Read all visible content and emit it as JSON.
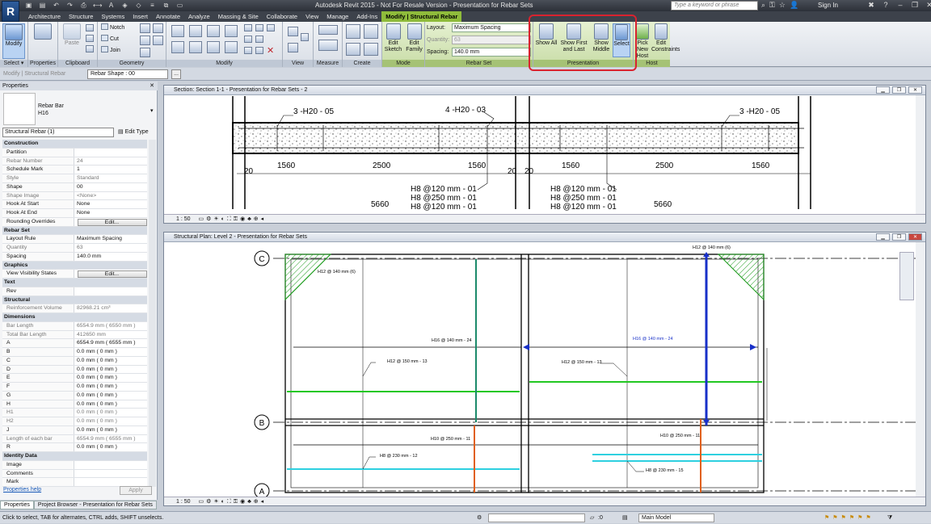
{
  "app": {
    "logo": "R",
    "window_title": "Autodesk Revit 2015 - Not For Resale Version -    Presentation for Rebar Sets",
    "search_placeholder": "Type a keyword or phrase",
    "sign_in": "Sign In"
  },
  "tabs": [
    "Architecture",
    "Structure",
    "Systems",
    "Insert",
    "Annotate",
    "Analyze",
    "Massing & Site",
    "Collaborate",
    "View",
    "Manage",
    "Add-Ins",
    "Modify | Structural Rebar"
  ],
  "active_tab_index": 11,
  "ribbon": {
    "select": {
      "modify": "Modify",
      "title": "Select ▾"
    },
    "properties": {
      "label": "Properties"
    },
    "clipboard": {
      "paste": "Paste",
      "title": "Clipboard"
    },
    "geometry": {
      "notch": "Notch",
      "cut": "Cut",
      "join": "Join",
      "title": "Geometry"
    },
    "modify": {
      "title": "Modify"
    },
    "view": {
      "title": "View"
    },
    "measure": {
      "title": "Measure"
    },
    "create": {
      "title": "Create"
    },
    "mode": {
      "edit_sketch": "Edit Sketch",
      "edit_family": "Edit Family",
      "title": "Mode"
    },
    "rebar_set": {
      "layout_label": "Layout:",
      "layout_value": "Maximum Spacing",
      "quantity_label": "Quantity:",
      "quantity_value": "63",
      "spacing_label": "Spacing:",
      "spacing_value": "140.0 mm",
      "title": "Rebar Set"
    },
    "presentation": {
      "show_all": "Show All",
      "show_first_last": "Show First and Last",
      "show_middle": "Show Middle",
      "select": "Select",
      "title": "Presentation"
    },
    "host": {
      "pick_new_host": "Pick New Host",
      "edit_constraints": "Edit Constraints",
      "title": "Host"
    }
  },
  "options_bar": {
    "label": "Modify | Structural Rebar",
    "rebar_shape": "Rebar Shape : 00",
    "more": "..."
  },
  "properties": {
    "header": "Properties",
    "type_name": "Rebar Bar",
    "type_sub": "H16",
    "instance_select": "Structural Rebar (1)",
    "edit_type": "Edit Type",
    "rows": [
      {
        "k": "Construction",
        "cat": true
      },
      {
        "k": "Partition",
        "v": ""
      },
      {
        "k": "Rebar Number",
        "v": "24",
        "ro": true
      },
      {
        "k": "Schedule Mark",
        "v": "1"
      },
      {
        "k": "Style",
        "v": "Standard",
        "ro": true
      },
      {
        "k": "Shape",
        "v": "00"
      },
      {
        "k": "Shape Image",
        "v": "<None>",
        "ro": true
      },
      {
        "k": "Hook At Start",
        "v": "None"
      },
      {
        "k": "Hook At End",
        "v": "None"
      },
      {
        "k": "Rounding Overrides",
        "v": "Edit...",
        "btn": true
      },
      {
        "k": "Rebar Set",
        "cat": true
      },
      {
        "k": "Layout Rule",
        "v": "Maximum Spacing"
      },
      {
        "k": "Quantity",
        "v": "63",
        "ro": true
      },
      {
        "k": "Spacing",
        "v": "140.0 mm"
      },
      {
        "k": "Graphics",
        "cat": true
      },
      {
        "k": "View Visibility States",
        "v": "Edit...",
        "btn": true
      },
      {
        "k": "Text",
        "cat": true
      },
      {
        "k": "Rev",
        "v": ""
      },
      {
        "k": "Structural",
        "cat": true
      },
      {
        "k": "Reinforcement Volume",
        "v": "82968.21 cm³",
        "ro": true
      },
      {
        "k": "Dimensions",
        "cat": true
      },
      {
        "k": "Bar Length",
        "v": "6554.9 mm ( 6550 mm )",
        "ro": true
      },
      {
        "k": "Total Bar Length",
        "v": "412650 mm",
        "ro": true
      },
      {
        "k": "A",
        "v": "6554.9 mm ( 6555 mm )"
      },
      {
        "k": "B",
        "v": "0.0 mm ( 0 mm )"
      },
      {
        "k": "C",
        "v": "0.0 mm ( 0 mm )"
      },
      {
        "k": "D",
        "v": "0.0 mm ( 0 mm )"
      },
      {
        "k": "E",
        "v": "0.0 mm ( 0 mm )"
      },
      {
        "k": "F",
        "v": "0.0 mm ( 0 mm )"
      },
      {
        "k": "G",
        "v": "0.0 mm ( 0 mm )"
      },
      {
        "k": "H",
        "v": "0.0 mm ( 0 mm )"
      },
      {
        "k": "H1",
        "v": "0.0 mm ( 0 mm )",
        "ro": true
      },
      {
        "k": "H2",
        "v": "0.0 mm ( 0 mm )",
        "ro": true
      },
      {
        "k": "J",
        "v": "0.0 mm ( 0 mm )"
      },
      {
        "k": "Length of each bar",
        "v": "6554.9 mm ( 6555 mm )",
        "ro": true
      },
      {
        "k": "R",
        "v": "0.0 mm ( 0 mm )"
      },
      {
        "k": "Identity Data",
        "cat": true
      },
      {
        "k": "Image",
        "v": ""
      },
      {
        "k": "Comments",
        "v": ""
      },
      {
        "k": "Mark",
        "v": ""
      }
    ],
    "help": "Properties help",
    "apply": "Apply"
  },
  "bottom_tabs": [
    "Properties",
    "Project Browser - Presentation for Rebar Sets"
  ],
  "section_view": {
    "title": "Section: Section 1-1 - Presentation for Rebar Sets - 2",
    "scale": "1 : 50",
    "labels": {
      "l1": "3 -H20 - 05",
      "l2": "4 -H20 - 03",
      "l3": "3 -H20 - 05",
      "d1": "1560",
      "d2": "2500",
      "d3": "1560",
      "d4": "1560",
      "d5": "2500",
      "d6": "1560",
      "e1": "20",
      "e2": "20",
      "e3": "20",
      "s1": "H8 @120 mm - 01",
      "s2": "H8 @250 mm - 01",
      "s3": "H8 @120 mm - 01",
      "s4": "H8 @120 mm - 01",
      "s5": "H8 @250 mm - 01",
      "s6": "H8 @120 mm - 01",
      "w1": "5660",
      "w2": "5660"
    }
  },
  "plan_view": {
    "title": "Structural Plan: Level 2 - Presentation for Rebar Sets",
    "scale": "1 : 50",
    "grids": {
      "c": "C",
      "b": "B",
      "a": "A"
    },
    "tags": {
      "t1": "H12 @ 140 mm (6)",
      "t2": "H12 @ 140 mm (6)",
      "t3": "H16 @ 140 mm - 24",
      "t4": "H16 @ 140 mm - 24",
      "t5": "H12 @ 150 mm - 13",
      "t6": "H12 @ 150 mm - 13",
      "t7": "H10 @ 250 mm - 11",
      "t8": "H10 @ 250 mm - 11",
      "t9": "H8 @ 230 mm - 12",
      "t10": "H8 @ 230 mm - 15"
    }
  },
  "status_bar": {
    "text": "Click to select, TAB for alternates, CTRL adds, SHIFT unselects.",
    "zero": ":0",
    "model": "Main Model"
  },
  "colors": {
    "accent_context": "#8fbc3b",
    "highlight": "#d9232f",
    "rebar_green": "#22c822",
    "rebar_blue": "#1830c8",
    "rebar_cyan": "#2ed0e0",
    "rebar_orange": "#e0601a"
  }
}
